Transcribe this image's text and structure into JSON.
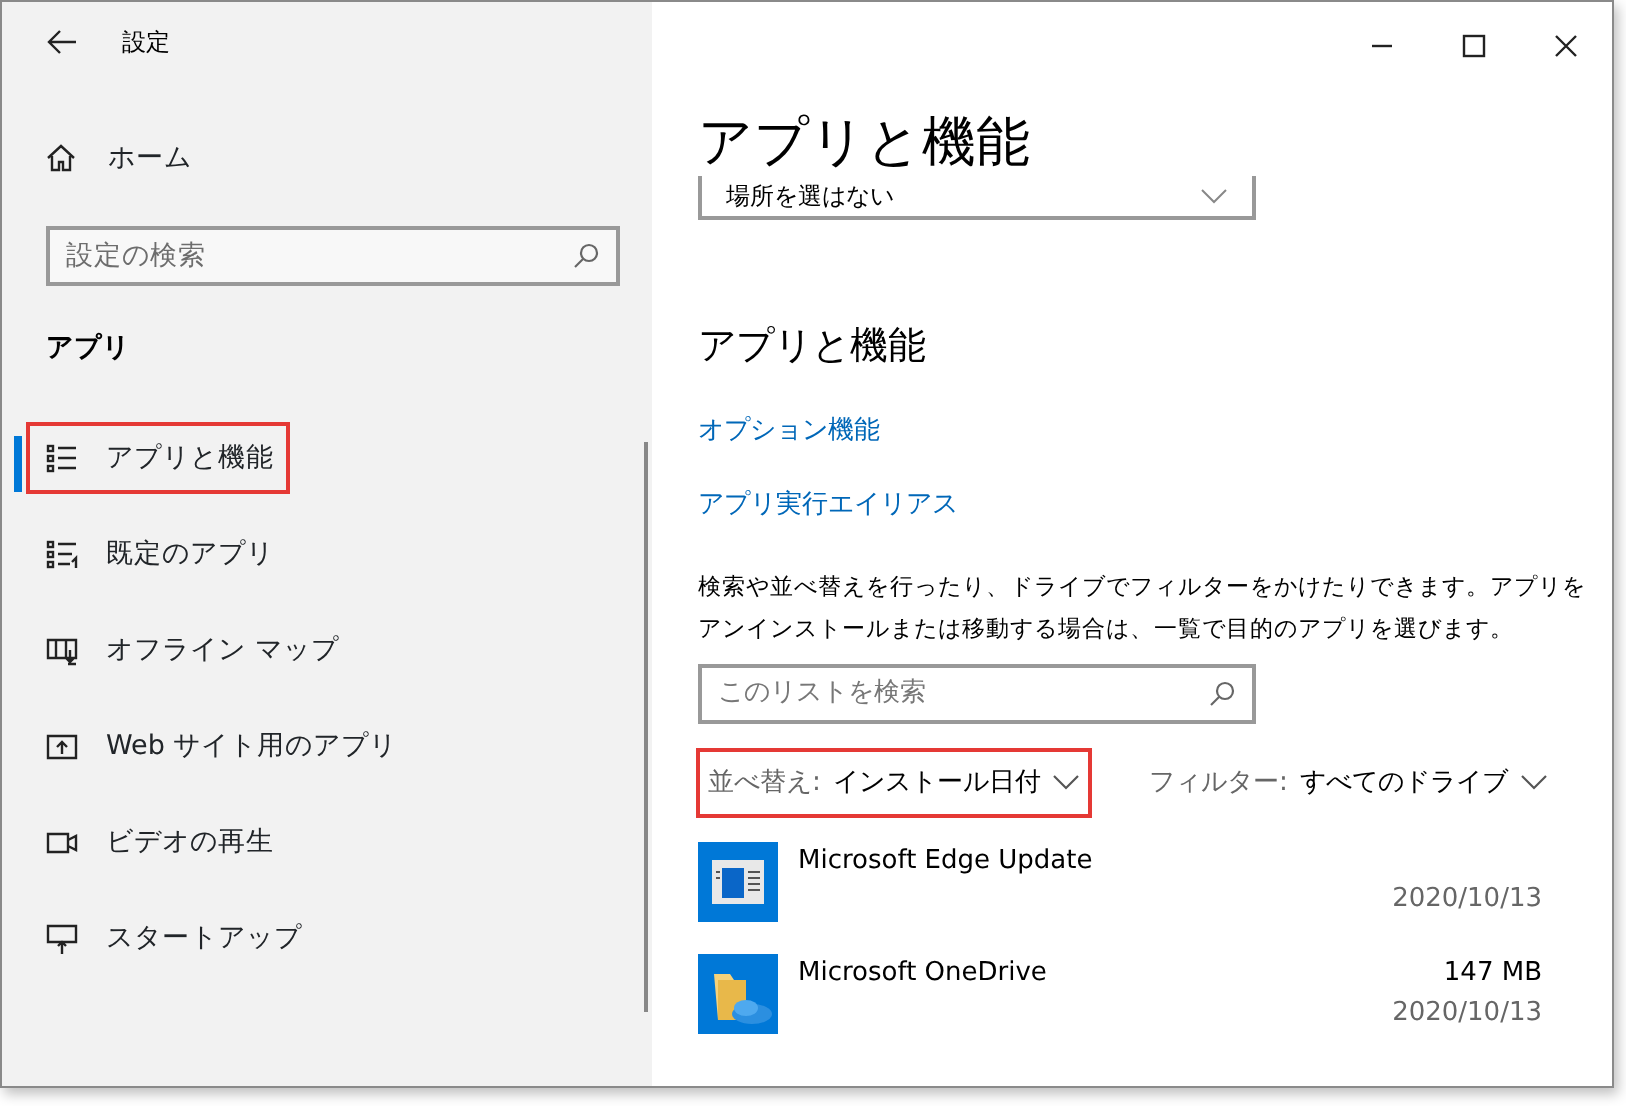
{
  "window": {
    "title": "設定"
  },
  "sidebar": {
    "home": "ホーム",
    "search": {
      "placeholder": "設定の検索"
    },
    "section": "アプリ",
    "items": [
      {
        "label": "アプリと機能",
        "kind": "list",
        "selected": true,
        "highlighted": true
      },
      {
        "label": "既定のアプリ",
        "kind": "listarrow",
        "selected": false,
        "highlighted": false
      },
      {
        "label": "オフライン マップ",
        "kind": "map",
        "selected": false,
        "highlighted": false
      },
      {
        "label": "Web サイト用のアプリ",
        "kind": "web",
        "selected": false,
        "highlighted": false
      },
      {
        "label": "ビデオの再生",
        "kind": "video",
        "selected": false,
        "highlighted": false
      },
      {
        "label": "スタートアップ",
        "kind": "startup",
        "selected": false,
        "highlighted": false
      }
    ]
  },
  "main": {
    "title": "アプリと機能",
    "location_dropdown": "場所を選はない",
    "heading": "アプリと機能",
    "links": [
      "オプション機能",
      "アプリ実行エイリアス"
    ],
    "description": "検索や並べ替えを行ったり、ドライブでフィルターをかけたりできます。アプリをアンインストールまたは移動する場合は、一覧で目的のアプリを選びます。",
    "search": {
      "placeholder": "このリストを検索"
    },
    "sort": {
      "label": "並べ替え:",
      "value": "インストール日付",
      "highlighted": true
    },
    "filter": {
      "label": "フィルター:",
      "value": "すべてのドライブ",
      "highlighted": false
    },
    "apps": [
      {
        "name": "Microsoft Edge Update",
        "kind": "update",
        "date": "2020/10/13"
      },
      {
        "name": "Microsoft OneDrive",
        "kind": "folder",
        "size": "147 MB",
        "date": "2020/10/13"
      }
    ]
  }
}
